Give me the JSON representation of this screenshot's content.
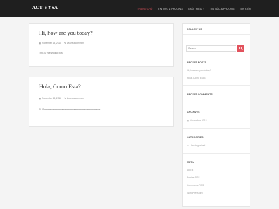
{
  "header": {
    "brand": "ACT-VYSA",
    "nav": [
      {
        "label": "Trang chủ",
        "active": true
      },
      {
        "label": "Tin tức & Phương",
        "active": false
      },
      {
        "label": "Giới thiệu",
        "active": false,
        "dropdown": true
      },
      {
        "label": "Tin tức & Phương",
        "active": false
      },
      {
        "label": "Dự kiến",
        "active": false
      }
    ]
  },
  "posts": [
    {
      "title": "Hi, how are you today?",
      "date": "November 18, 2018",
      "comments": "Leave a comment",
      "body": "This is the second post"
    },
    {
      "title": "Hola, Como Esta?",
      "date": "November 18, 2018",
      "comments": "Leave a comment",
      "body": "PHRaaaaaaaaaaaaaaaaaaaaaaaaaaaaaaaaaaaaaaaaaaa"
    }
  ],
  "sidebar": {
    "follow_title": "Follow us",
    "search_placeholder": "Search...",
    "recent_posts_title": "Recent Posts",
    "recent_posts": [
      "Hi, how are you today?",
      "Hola, Como Esta?"
    ],
    "recent_comments_title": "Recent Comments",
    "archives_title": "Archives",
    "archives": [
      "November 2018"
    ],
    "categories_title": "Categories",
    "categories": [
      "Uncategorized"
    ],
    "meta_title": "Meta",
    "meta_links": [
      "Log in",
      "Entries RSS",
      "Comments RSS",
      "WordPress.org"
    ]
  },
  "colors": {
    "accent": "#e2525c",
    "navbar": "#1f1f1f",
    "background": "#f4f4f4"
  }
}
